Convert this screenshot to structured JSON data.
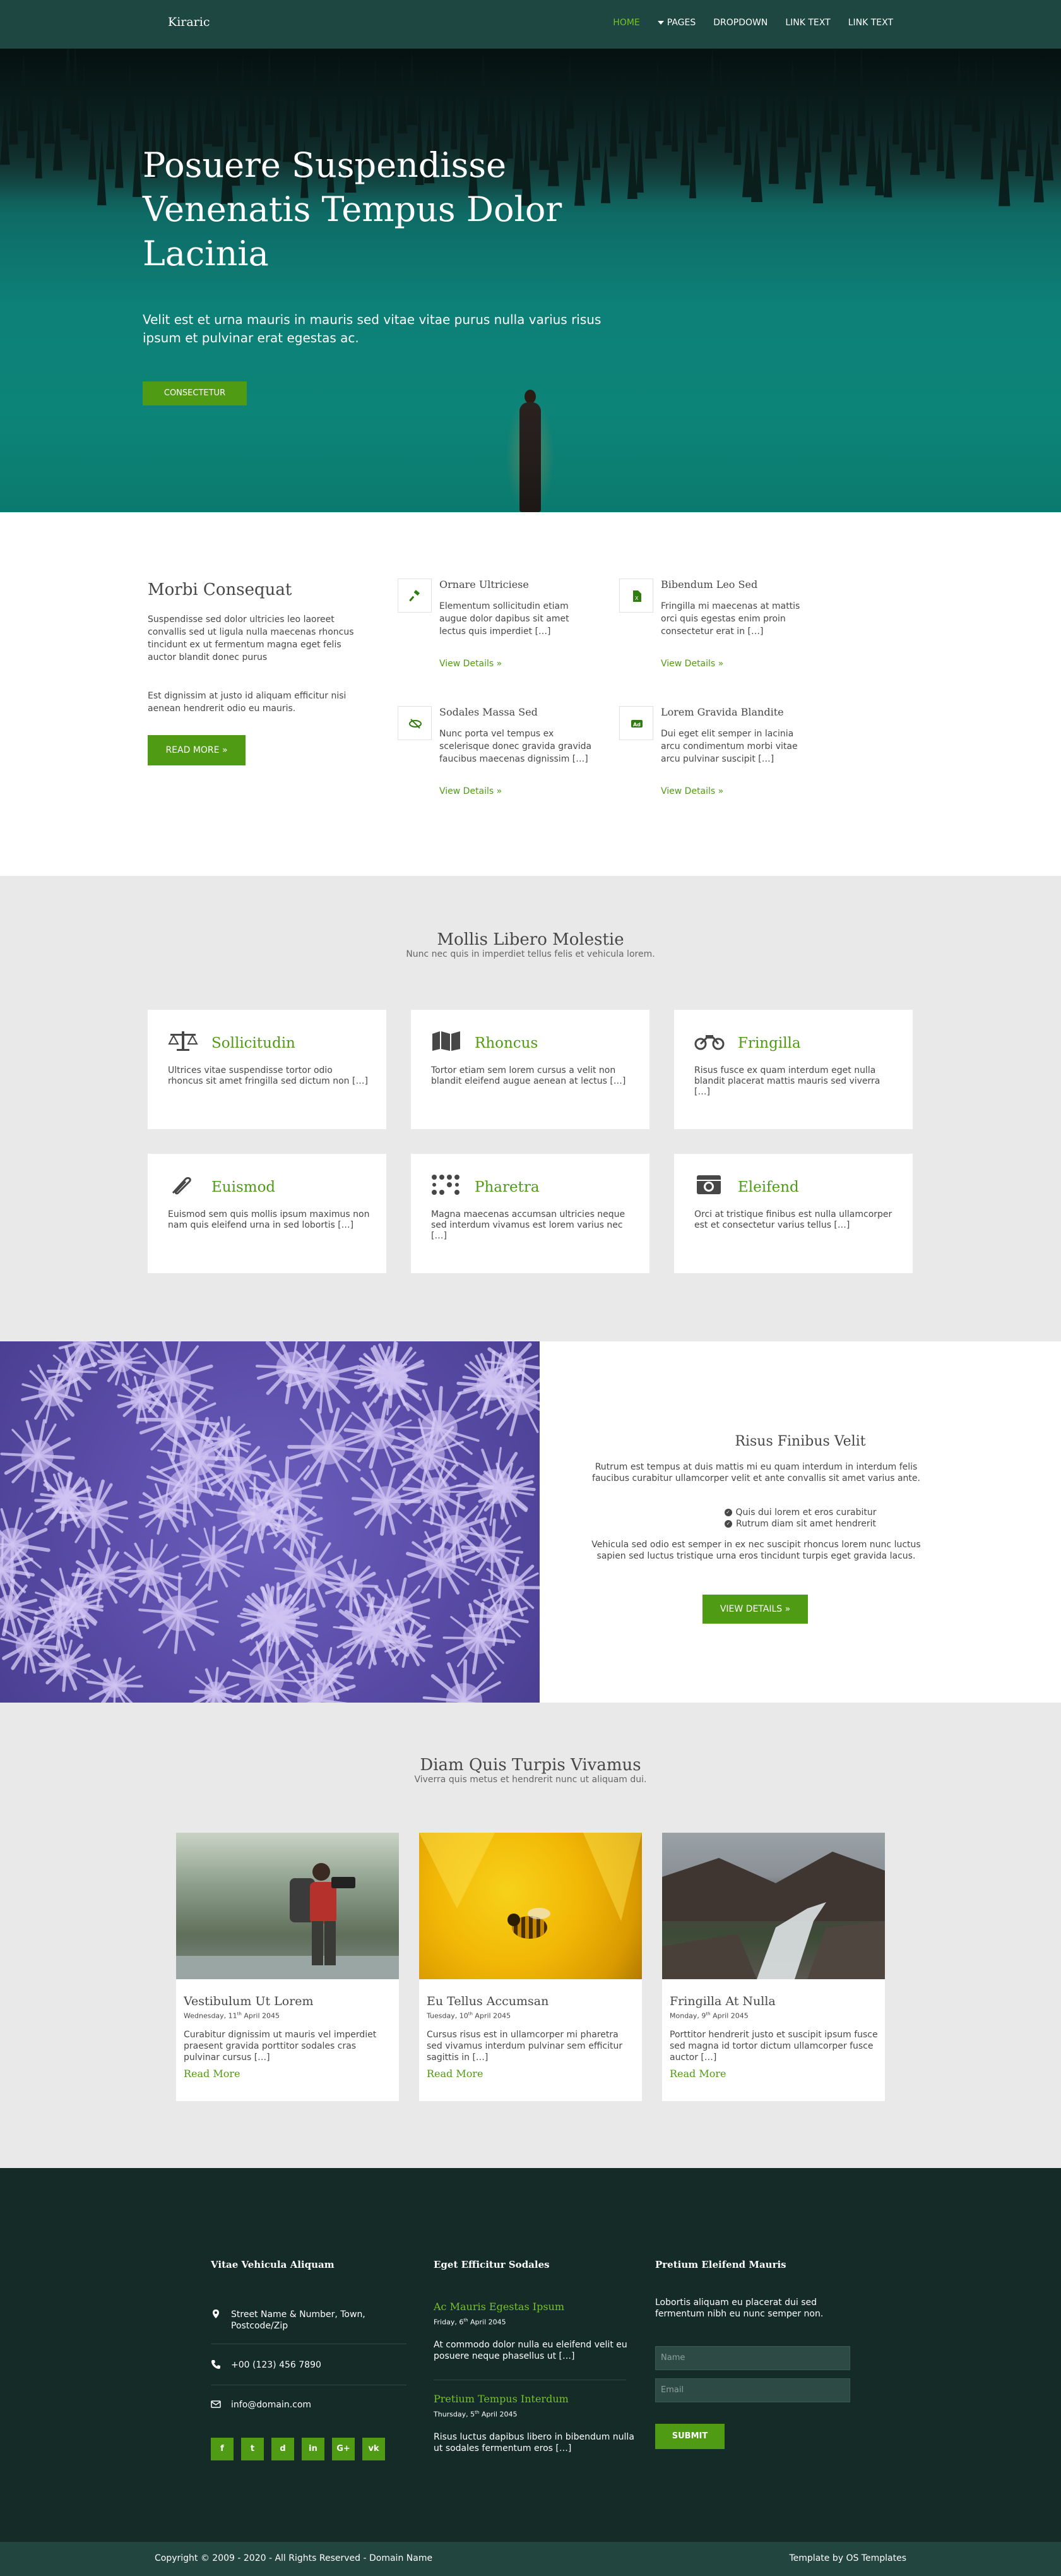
{
  "header": {
    "logo": "Kiraric",
    "nav": [
      {
        "label": "Home",
        "active": true
      },
      {
        "label": "Pages",
        "has_caret": true
      },
      {
        "label": "Dropdown"
      },
      {
        "label": "Link Text"
      },
      {
        "label": "Link Text"
      }
    ]
  },
  "hero": {
    "title": "Posuere Suspendisse Venenatis Tempus Dolor Lacinia",
    "text": "Velit est et urna mauris in mauris sed vitae vitae purus nulla varius risus ipsum et pulvinar erat egestas ac.",
    "button": "Consectetur"
  },
  "intro": {
    "title": "Morbi Consequat",
    "para1": "Suspendisse sed dolor ultricies leo laoreet convallis sed ut ligula nulla maecenas rhoncus tincidunt ex ut fermentum magna eget felis auctor blandit donec purus",
    "para2": "Est dignissim at justo id aliquam efficitur nisi aenean hendrerit odio eu mauris.",
    "button": "Read More »",
    "features": [
      {
        "icon": "gavel-icon",
        "title": "Ornare Ultriciese",
        "text": "Elementum sollicitudin etiam augue dolor dapibus sit amet lectus quis imperdiet […]",
        "link": "View Details »"
      },
      {
        "icon": "file-excel-icon",
        "title": "Bibendum Leo Sed",
        "text": "Fringilla mi maecenas at mattis orci quis egestas enim proin consectetur erat in […]",
        "link": "View Details »"
      },
      {
        "icon": "low-vision-icon",
        "title": "Sodales Massa Sed",
        "text": "Nunc porta vel tempus ex scelerisque donec gravida gravida faucibus maecenas dignissim […]",
        "link": "View Details »"
      },
      {
        "icon": "ad-icon",
        "title": "Lorem Gravida Blandite",
        "text": "Dui eget elit semper in lacinia arcu condimentum morbi vitae arcu pulvinar suscipit […]",
        "link": "View Details »"
      }
    ]
  },
  "services": {
    "title": "Mollis Libero Molestie",
    "subtitle": "Nunc nec quis in imperdiet tellus felis et vehicula lorem.",
    "cards": [
      {
        "icon": "balance-scale-icon",
        "title": "Sollicitudin",
        "text": "Ultrices vitae suspendisse tortor odio rhoncus sit amet fringilla sed dictum non […]"
      },
      {
        "icon": "map-icon",
        "title": "Rhoncus",
        "text": "Tortor etiam sem lorem cursus a velit non blandit eleifend augue aenean at lectus […]"
      },
      {
        "icon": "motorcycle-icon",
        "title": "Fringilla",
        "text": "Risus fusce ex quam interdum eget nulla blandit placerat mattis mauris sed viverra […]"
      },
      {
        "icon": "paperclip-icon",
        "title": "Euismod",
        "text": "Euismod sem quis mollis ipsum maximus non nam quis eleifend urna in sed lobortis […]"
      },
      {
        "icon": "braille-icon",
        "title": "Pharetra",
        "text": "Magna maecenas accumsan ultricies neque sed interdum vivamus est lorem varius nec […]"
      },
      {
        "icon": "camera-retro-icon",
        "title": "Eleifend",
        "text": "Orci at tristique finibus est nulla ullamcorper est et consectetur varius tellus […]"
      }
    ]
  },
  "split": {
    "title": "Risus Finibus Velit",
    "lead": "Rutrum est tempus at duis mattis mi eu quam interdum in interdum felis faucibus curabitur ullamcorper velit et ante convallis sit amet varius ante.",
    "list": [
      "Quis dui lorem et eros curabitur",
      "Rutrum diam sit amet hendrerit"
    ],
    "body": "Vehicula sed odio est semper in ex nec suscipit rhoncus lorem nunc luctus sapien sed luctus tristique urna eros tincidunt turpis eget gravida lacus.",
    "button": "View Details »"
  },
  "blog": {
    "title": "Diam Quis Turpis Vivamus",
    "subtitle": "Viverra quis metus et hendrerit nunc ut aliquam dui.",
    "posts": [
      {
        "title": "Vestibulum Ut Lorem",
        "day": "Wednesday, 11",
        "sup": "th",
        "rest": " April 2045",
        "text": "Curabitur dignissim ut mauris vel imperdiet praesent gravida porttitor sodales cras pulvinar cursus […]",
        "link": "Read More"
      },
      {
        "title": "Eu Tellus Accumsan",
        "day": "Tuesday, 10",
        "sup": "th",
        "rest": " April 2045",
        "text": "Cursus risus est in ullamcorper mi pharetra sed vivamus interdum pulvinar sem efficitur sagittis in […]",
        "link": "Read More"
      },
      {
        "title": "Fringilla At Nulla",
        "day": "Monday, 9",
        "sup": "th",
        "rest": " April 2045",
        "text": "Porttitor hendrerit justo et suscipit ipsum fusce sed magna id tortor dictum ullamcorper fusce auctor […]",
        "link": "Read More"
      }
    ]
  },
  "footer": {
    "col1_title": "Vitae Vehicula Aliquam",
    "address": "Street Name & Number, Town, Postcode/Zip",
    "phone": "+00 (123) 456 7890",
    "email": "info@domain.com",
    "socials": [
      "f",
      "t",
      "d",
      "in",
      "G+",
      "vk"
    ],
    "col2_title": "Eget Efficitur Sodales",
    "posts": [
      {
        "title": "Ac Mauris Egestas Ipsum",
        "day": "Friday, 6",
        "sup": "th",
        "rest": " April 2045",
        "text": "At commodo dolor nulla eu eleifend velit eu posuere neque phasellus ut […]"
      },
      {
        "title": "Pretium Tempus Interdum",
        "day": "Thursday, 5",
        "sup": "th",
        "rest": " April 2045",
        "text": "Risus luctus dapibus libero in bibendum nulla ut sodales fermentum eros […]"
      }
    ],
    "col3_title": "Pretium Eleifend Mauris",
    "newsletter_text": "Lobortis aliquam eu placerat dui sed fermentum nibh eu nunc semper non.",
    "name_placeholder": "Name",
    "email_placeholder": "Email",
    "submit": "Submit"
  },
  "copyright": {
    "left": "Copyright © 2009 - 2020 - All Rights Reserved - Domain Name",
    "right": "Template by OS Templates"
  },
  "colors": {
    "accent": "#4f9b14",
    "header": "#1e4742",
    "footer": "#142b27",
    "teal": "#0d8077"
  }
}
